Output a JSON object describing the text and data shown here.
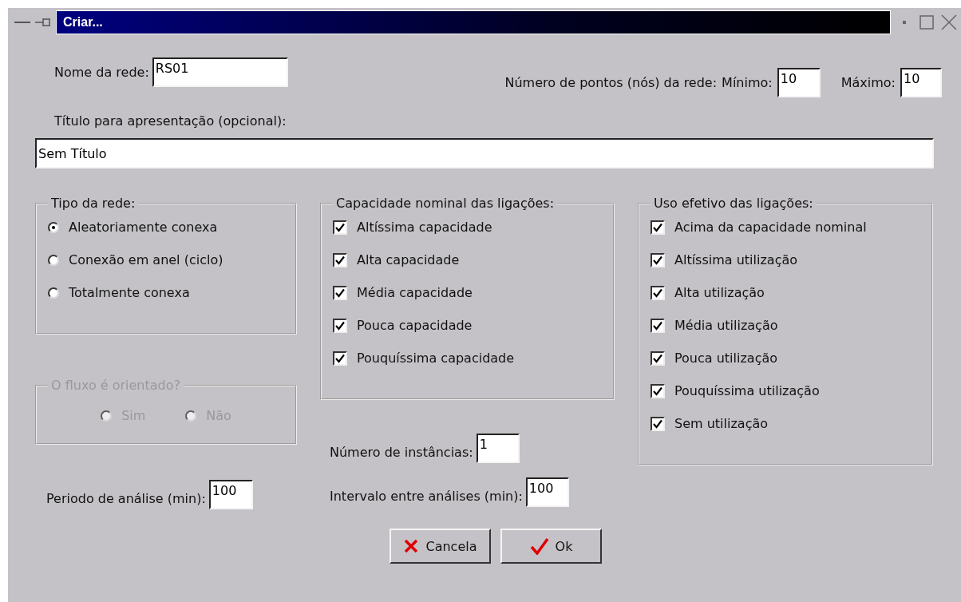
{
  "window": {
    "title": "Criar..."
  },
  "network_name": {
    "label": "Nome da rede:",
    "value": "RS01"
  },
  "node_count": {
    "label": "Número de pontos (nós) da rede:",
    "min_label": "Mínimo:",
    "min_value": "10",
    "max_label": "Máximo:",
    "max_value": "10"
  },
  "display_title": {
    "label": "Título para apresentação (opcional):",
    "value": "Sem Título"
  },
  "network_type": {
    "title": "Tipo da rede:",
    "options": [
      {
        "label": "Aleatoriamente conexa",
        "selected": true
      },
      {
        "label": "Conexão em anel (ciclo)",
        "selected": false
      },
      {
        "label": "Totalmente conexa",
        "selected": false
      }
    ]
  },
  "flow_direction": {
    "title": "O fluxo é orientado?",
    "disabled": true,
    "options": [
      {
        "label": "Sim",
        "selected": false
      },
      {
        "label": "Não",
        "selected": false
      }
    ]
  },
  "nominal_capacity": {
    "title": "Capacidade nominal das ligações:",
    "items": [
      {
        "label": "Altíssima capacidade",
        "checked": true
      },
      {
        "label": "Alta capacidade",
        "checked": true
      },
      {
        "label": "Média capacidade",
        "checked": true
      },
      {
        "label": "Pouca capacidade",
        "checked": true
      },
      {
        "label": "Pouquíssima capacidade",
        "checked": true
      }
    ]
  },
  "effective_usage": {
    "title": "Uso efetivo das ligações:",
    "items": [
      {
        "label": "Acima da capacidade nominal",
        "checked": true
      },
      {
        "label": "Altíssima utilização",
        "checked": true
      },
      {
        "label": "Alta utilização",
        "checked": true
      },
      {
        "label": "Média utilização",
        "checked": true
      },
      {
        "label": "Pouca utilização",
        "checked": true
      },
      {
        "label": "Pouquíssima utilização",
        "checked": true
      },
      {
        "label": "Sem utilização",
        "checked": true
      }
    ]
  },
  "instances": {
    "label": "Número de instâncias:",
    "value": "1"
  },
  "analysis_period": {
    "label": "Periodo de análise (min):",
    "value": "100"
  },
  "analysis_interval": {
    "label": "Intervalo entre análises (min):",
    "value": "100"
  },
  "buttons": [
    {
      "label": "Cancela",
      "kind": "cancel"
    },
    {
      "label": "Ok",
      "kind": "ok"
    }
  ]
}
